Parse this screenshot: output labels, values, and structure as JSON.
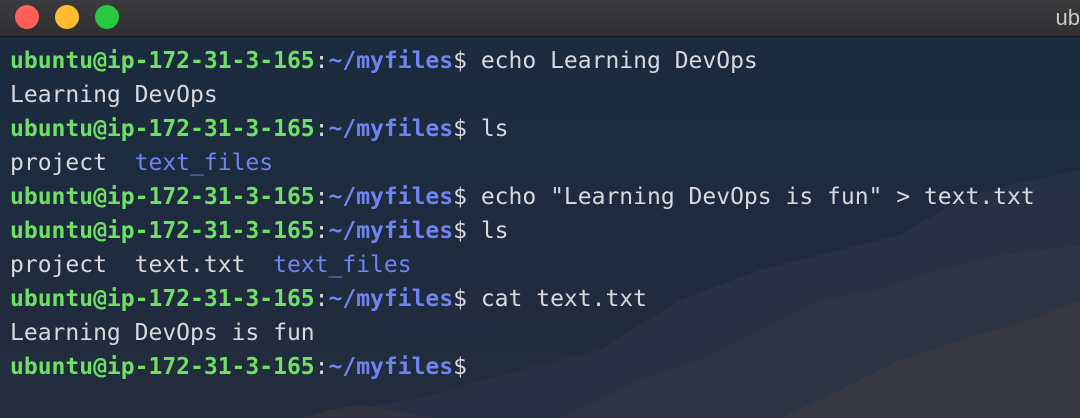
{
  "window": {
    "title": "ub"
  },
  "prompt": {
    "user_host": "ubuntu@ip-172-31-3-165",
    "colon": ":",
    "path": "~/myfiles",
    "dollar": "$"
  },
  "lines": [
    {
      "type": "prompt",
      "command": " echo Learning DevOps"
    },
    {
      "type": "output",
      "text": "Learning DevOps"
    },
    {
      "type": "prompt",
      "command": " ls"
    },
    {
      "type": "listing",
      "items": [
        {
          "text": "project",
          "kind": "file"
        },
        {
          "text": "text_files",
          "kind": "dir"
        }
      ]
    },
    {
      "type": "prompt",
      "command": " echo \"Learning DevOps is fun\" > text.txt"
    },
    {
      "type": "prompt",
      "command": " ls"
    },
    {
      "type": "listing",
      "items": [
        {
          "text": "project",
          "kind": "file"
        },
        {
          "text": "text.txt",
          "kind": "file"
        },
        {
          "text": "text_files",
          "kind": "dir"
        }
      ]
    },
    {
      "type": "prompt",
      "command": " cat text.txt"
    },
    {
      "type": "output",
      "text": "Learning DevOps is fun"
    },
    {
      "type": "prompt",
      "command": ""
    }
  ],
  "colors": {
    "user_host": "#6fe066",
    "path": "#6f83f2",
    "directory": "#6f83f2",
    "text": "#d7d9de",
    "traffic_red": "#ff5f57",
    "traffic_yellow": "#febc2e",
    "traffic_green": "#28c840"
  }
}
